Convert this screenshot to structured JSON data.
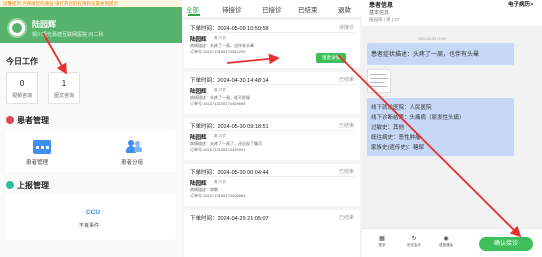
{
  "panel1": {
    "notice": "温馨提示:为保障您的收益,请打开您的权限和设置收到提示",
    "doctor_name": "陆园辉",
    "hospital": "铜川银光嘉德互联网医院 内二科",
    "today_title": "今日工作",
    "stats": [
      {
        "num": "0",
        "label": "视频咨询"
      },
      {
        "num": "1",
        "label": "图文咨询"
      }
    ],
    "patient_section": "患者管理",
    "patient_items": [
      {
        "label": "患者管理"
      },
      {
        "label": "患者分组"
      }
    ],
    "report_section": "上报管理",
    "report_icon_text": "CCU",
    "report_item": "不良事件"
  },
  "panel2": {
    "tabs": [
      "全部",
      "待接诊",
      "已接诊",
      "已结束",
      "退款"
    ],
    "accept_button": "患者详情",
    "orders": [
      {
        "time": "下单时间：2024-05-09 10:59:58",
        "status": "待接诊",
        "name": "陆园辉",
        "meta": "男 27岁",
        "desc": "病情描述：头疼了一周，也伴有头晕",
        "oid": "订单号:1616713155174352299"
      },
      {
        "time": "下单时间：2024-04-30 14:48:14",
        "status": "已结束",
        "name": "陆园辉",
        "meta": "男 27岁",
        "desc": "病情描述：头疼了一周，谁不舒服",
        "oid": "订单号:1616713155174459694"
      },
      {
        "time": "下单时间：2024-05-30 09:18:51",
        "status": "已结束",
        "name": "陆园辉",
        "meta": "男 27岁",
        "desc": "病情描述：头疼了一周了，还出现了腹泻",
        "oid": "订单号:1616713155174439931"
      },
      {
        "time": "下单时间：2024-05-30 00:04:44",
        "status": "已结束",
        "name": "陆园辉",
        "meta": "男 27岁",
        "desc": "病情描述：咳嗽",
        "oid": "订单号:1616713155174406684"
      },
      {
        "time": "下单时间：2024-04-29 21:05:07",
        "status": "已结束"
      }
    ]
  },
  "panel3": {
    "title": "患者信息",
    "right_link": "电子病历>",
    "subtitle": "基本信息",
    "patient_line": "陆园辉 | 男 | 27",
    "timestamp": "2024-05-09 10:59",
    "complaint": "患者症状描述：头疼了一周，也伴有头晕",
    "info_lines": [
      "线下就诊医院：人民医院",
      "线下诊断结果：头痛病（原发性头痛）",
      "过敏史：其他",
      "既往病史：恶性肿瘤",
      "家族史(遗传史)：糖尿"
    ],
    "bottom_items": [
      "更多",
      "历史会诊",
      "语音通话"
    ],
    "accept_button": "确认接诊"
  },
  "colors": {
    "brand_green": "#57b36b",
    "accept_green": "#3fbf5a",
    "bubble_blue": "#c6d8f5",
    "annotation_red": "#e83030"
  }
}
